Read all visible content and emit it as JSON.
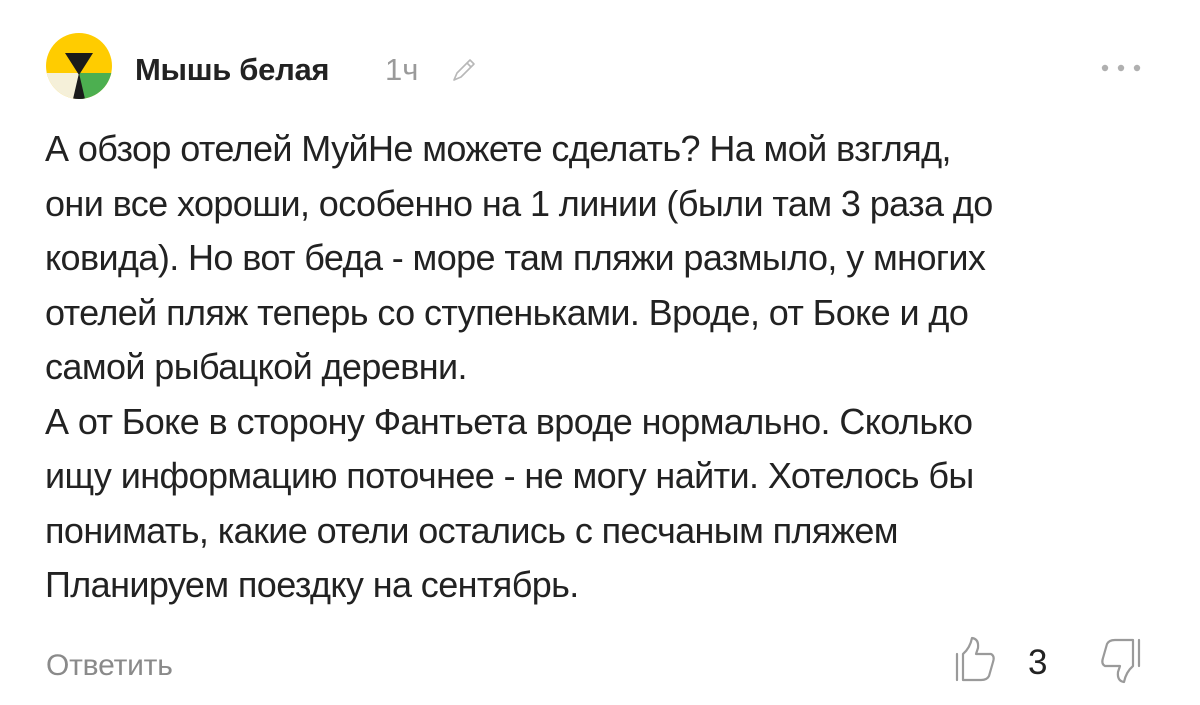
{
  "comment": {
    "author": "Мышь белая",
    "time": "1ч",
    "avatar_icon": "yandex-avatar-icon",
    "edit_icon": "pencil-icon",
    "more_icon": "more-dots-icon",
    "body_lines": [
      "А обзор отелей МуйНе можете сделать? На мой взгляд,",
      "они все хороши, особенно на 1 линии (были там 3 раза до",
      "ковида). Но вот беда - море там пляжи размыло, у многих",
      "отелей пляж теперь со ступеньками. Вроде, от Боке и до",
      "самой рыбацкой деревни.",
      "А от Боке в сторону Фантьета вроде нормально. Сколько",
      "ищу информацию поточнее - не могу найти. Хотелось бы",
      "понимать, какие отели остались с песчаным пляжем",
      "Планируем поездку на сентябрь."
    ],
    "actions": {
      "reply_label": "Ответить",
      "like_icon": "thumbs-up-icon",
      "like_count": "3",
      "dislike_icon": "thumbs-down-icon"
    },
    "colors": {
      "avatar_yellow": "#FFCC00",
      "avatar_green": "#4CAF50",
      "avatar_beige": "#F5F0D9",
      "text": "#222222",
      "muted": "#9A9A9A"
    }
  }
}
